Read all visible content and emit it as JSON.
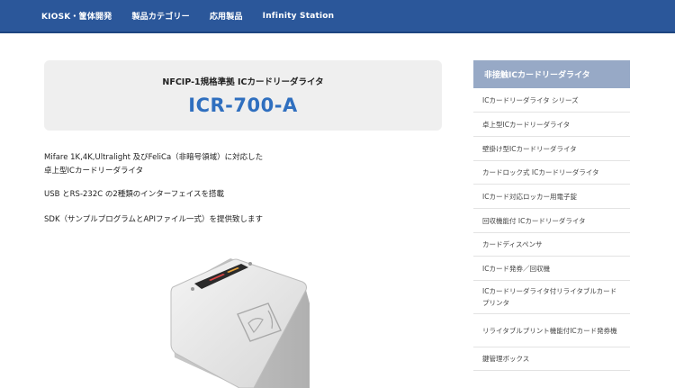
{
  "nav": {
    "items": [
      "KIOSK・筐体開発",
      "製品カテゴリー",
      "応用製品",
      "Infinity Station"
    ]
  },
  "hero": {
    "subtitle": "NFCIP-1規格準拠 ICカードリーダライタ",
    "title": "ICR-700-A"
  },
  "description": {
    "line1": "Mifare 1K,4K,Ultralight 及びFeliCa（非暗号領域）に対応した",
    "line2": "卓上型ICカードリーダライタ",
    "line3": "USB とRS-232C の2種類のインターフェイスを搭載",
    "line4": "SDK（サンプルプログラムとAPIファイル一式）を提供致します"
  },
  "sidebar": {
    "heading": "非接触ICカードリーダライタ",
    "items": [
      "ICカードリーダライタ シリーズ",
      "卓上型ICカードリーダライタ",
      "壁掛け型ICカードリーダライタ",
      "カードロック式 ICカードリーダライタ",
      "ICカード対応ロッカー用電子錠",
      "回収機能付 ICカードリーダライタ",
      "カードディスペンサ",
      "ICカード発券／回収機",
      "ICカードリーダライタ付リライタブルカードプリンタ",
      "リライタブルプリント機能付ICカード発券機",
      "鍵管理ボックス"
    ]
  },
  "colors": {
    "nav_bg": "#2b579a",
    "title_blue": "#2f6fbf",
    "sidebar_head_bg": "#97a9c6"
  }
}
